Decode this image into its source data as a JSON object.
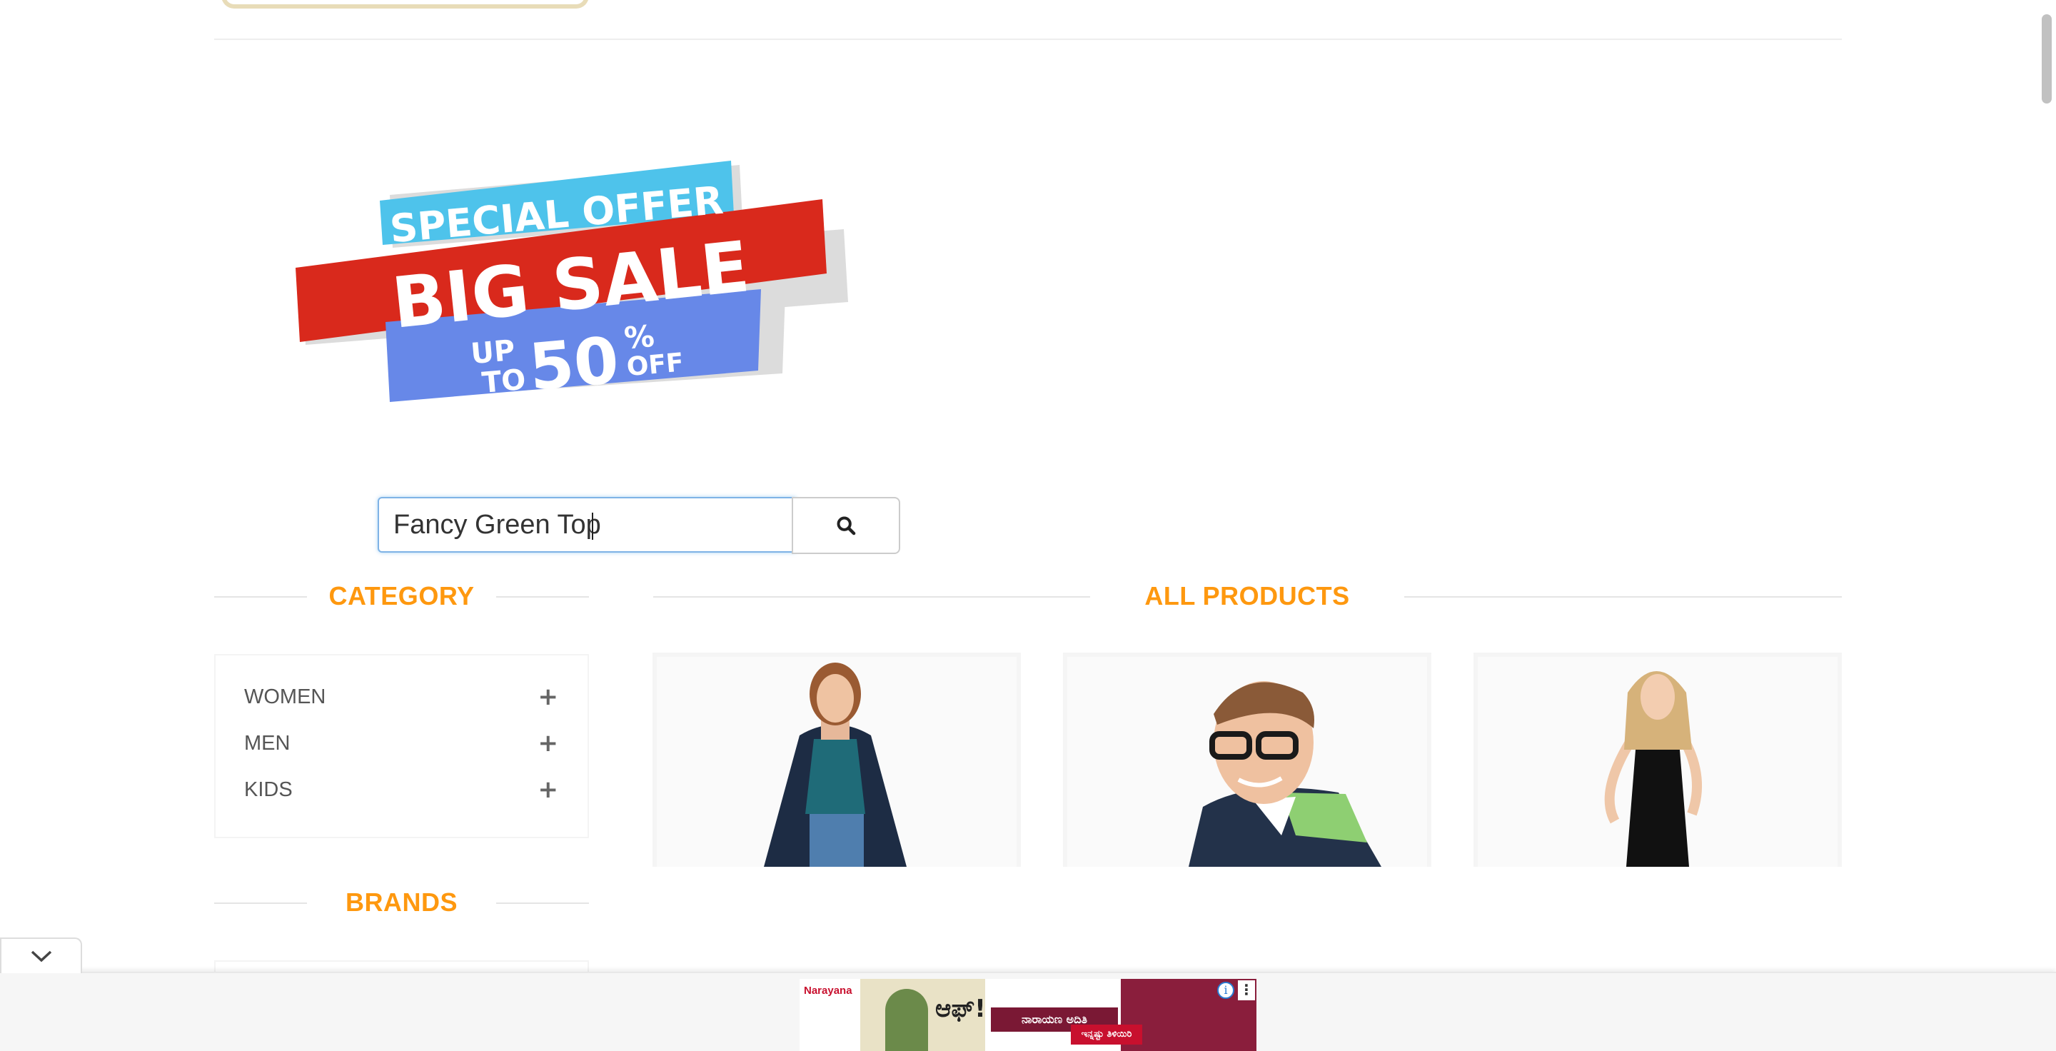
{
  "banner": {
    "line1": "SPECIAL OFFER",
    "line2": "BIG SALE",
    "up": "UP",
    "to": "TO",
    "percent": "50",
    "percent_sign": "%",
    "off": "OFF"
  },
  "search": {
    "value": "Fancy Green Top",
    "button_icon": "search-icon"
  },
  "sidebar": {
    "category_title": "CATEGORY",
    "categories": [
      {
        "label": "WOMEN",
        "icon": "plus-icon"
      },
      {
        "label": "MEN",
        "icon": "plus-icon"
      },
      {
        "label": "KIDS",
        "icon": "plus-icon"
      }
    ],
    "brands_title": "BRANDS"
  },
  "main": {
    "title": "ALL PRODUCTS"
  },
  "ad": {
    "brand": "Narayana",
    "headline": "ಆಫ್!",
    "subhead": "ನಾರಾಯಣ ಅದಿತಿ",
    "cta": "ಇನ್ನಷ್ಟು ತಿಳಿಯಿರಿ",
    "info_icon": "info-icon",
    "menu_icon": "more-vertical-icon"
  },
  "colors": {
    "accent": "#fe980f",
    "banner_blue_top": "#4ec3eb",
    "banner_red": "#d9291c",
    "banner_blue_bottom": "#6788e8"
  }
}
